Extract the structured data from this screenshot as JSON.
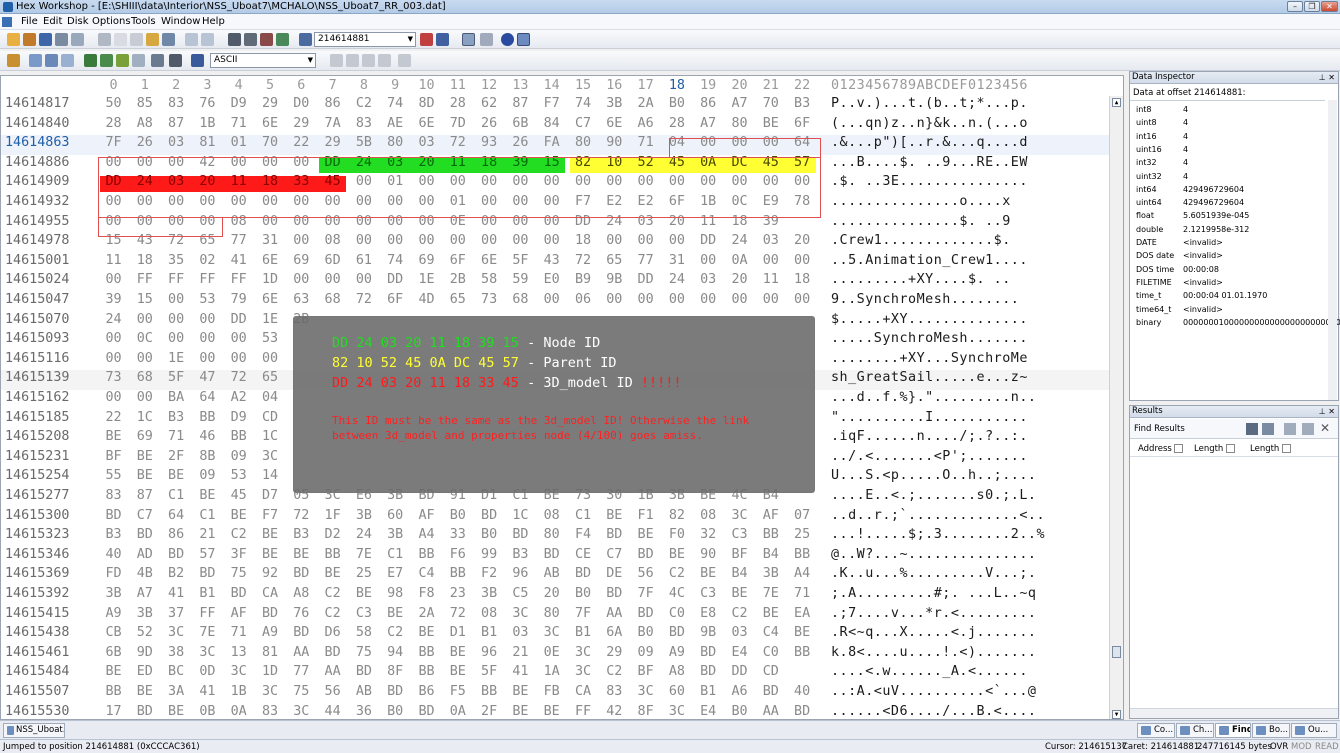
{
  "window": {
    "title": "Hex Workshop - [E:\\SHIII\\data\\Interior\\NSS_Uboat7\\MCHALO\\NSS_Uboat7_RR_003.dat]",
    "min": "–",
    "restore": "❐",
    "close": "✕"
  },
  "menu": [
    "File",
    "Edit",
    "Disk",
    "Options",
    "Tools",
    "Window",
    "Help"
  ],
  "toolbar": {
    "goto_value": "214614881",
    "charset": "ASCII"
  },
  "editor": {
    "col_headers": [
      "0",
      "1",
      "2",
      "3",
      "4",
      "5",
      "6",
      "7",
      "8",
      "9",
      "10",
      "11",
      "12",
      "13",
      "14",
      "15",
      "16",
      "17",
      "18",
      "19",
      "20",
      "21",
      "22"
    ],
    "ascii_header": "0123456789ABCDEF0123456",
    "rows": [
      {
        "off": "14614817",
        "hex": [
          "50",
          "85",
          "83",
          "76",
          "D9",
          "29",
          "D0",
          "86",
          "C2",
          "74",
          "8D",
          "28",
          "62",
          "87",
          "F7",
          "74",
          "3B",
          "2A",
          "B0",
          "86",
          "A7",
          "70",
          "B3"
        ],
        "ascii": "P..v.)...t.(b..t;*...p."
      },
      {
        "off": "14614840",
        "hex": [
          "28",
          "A8",
          "87",
          "1B",
          "71",
          "6E",
          "29",
          "7A",
          "83",
          "AE",
          "6E",
          "7D",
          "26",
          "6B",
          "84",
          "C7",
          "6E",
          "A6",
          "28",
          "A7",
          "80",
          "BE",
          "6F"
        ],
        "ascii": "(...qn)z..n}&k..n.(...o"
      },
      {
        "off": "14614863",
        "hex": [
          "7F",
          "26",
          "03",
          "81",
          "01",
          "70",
          "22",
          "29",
          "5B",
          "80",
          "03",
          "72",
          "93",
          "26",
          "FA",
          "80",
          "90",
          "71",
          "04",
          "00",
          "00",
          "00",
          "64"
        ],
        "ascii": ".&...p\")[..r.&...q....d"
      },
      {
        "off": "14614886",
        "hex": [
          "00",
          "00",
          "00",
          "42",
          "00",
          "00",
          "00",
          "DD",
          "24",
          "03",
          "20",
          "11",
          "18",
          "39",
          "15",
          "82",
          "10",
          "52",
          "45",
          "0A",
          "DC",
          "45",
          "57"
        ],
        "ascii": "...B....$. ..9...RE..EW"
      },
      {
        "off": "14614909",
        "hex": [
          "DD",
          "24",
          "03",
          "20",
          "11",
          "18",
          "33",
          "45",
          "00",
          "01",
          "00",
          "00",
          "00",
          "00",
          "00",
          "00",
          "00",
          "00",
          "00",
          "00",
          "00",
          "00",
          "00"
        ],
        "ascii": ".$. ..3E..............."
      },
      {
        "off": "14614932",
        "hex": [
          "00",
          "00",
          "00",
          "00",
          "00",
          "00",
          "00",
          "00",
          "00",
          "00",
          "00",
          "01",
          "00",
          "00",
          "00",
          "F7",
          "E2",
          "E2",
          "6F",
          "1B",
          "0C",
          "E9",
          "78"
        ],
        "ascii": "...............o....x"
      },
      {
        "off": "14614955",
        "hex": [
          "00",
          "00",
          "00",
          "00",
          "08",
          "00",
          "00",
          "00",
          "00",
          "00",
          "00",
          "0E",
          "00",
          "00",
          "00",
          "DD",
          "24",
          "03",
          "20",
          "11",
          "18",
          "39"
        ],
        "ascii": "...............$. ..9"
      },
      {
        "off": "14614978",
        "hex": [
          "15",
          "43",
          "72",
          "65",
          "77",
          "31",
          "00",
          "08",
          "00",
          "00",
          "00",
          "00",
          "00",
          "00",
          "00",
          "18",
          "00",
          "00",
          "00",
          "DD",
          "24",
          "03",
          "20"
        ],
        "ascii": ".Crew1.............$. "
      },
      {
        "off": "14615001",
        "hex": [
          "11",
          "18",
          "35",
          "02",
          "41",
          "6E",
          "69",
          "6D",
          "61",
          "74",
          "69",
          "6F",
          "6E",
          "5F",
          "43",
          "72",
          "65",
          "77",
          "31",
          "00",
          "0A",
          "00",
          "00"
        ],
        "ascii": "..5.Animation_Crew1...."
      },
      {
        "off": "14615024",
        "hex": [
          "00",
          "FF",
          "FF",
          "FF",
          "FF",
          "1D",
          "00",
          "00",
          "00",
          "DD",
          "1E",
          "2B",
          "58",
          "59",
          "E0",
          "B9",
          "9B",
          "DD",
          "24",
          "03",
          "20",
          "11",
          "18"
        ],
        "ascii": ".........+XY....$. .."
      },
      {
        "off": "14615047",
        "hex": [
          "39",
          "15",
          "00",
          "53",
          "79",
          "6E",
          "63",
          "68",
          "72",
          "6F",
          "4D",
          "65",
          "73",
          "68",
          "00",
          "06",
          "00",
          "00",
          "00",
          "00",
          "00",
          "00",
          "00"
        ],
        "ascii": "9..SynchroMesh........"
      },
      {
        "off": "14615070",
        "hex": [
          "24",
          "00",
          "00",
          "00",
          "DD",
          "1E",
          "2B"
        ],
        "ascii": "$.....+XY.............."
      },
      {
        "off": "14615093",
        "hex": [
          "00",
          "0C",
          "00",
          "00",
          "00",
          "53"
        ],
        "ascii": ".....SynchroMesh......."
      },
      {
        "off": "14615116",
        "hex": [
          "00",
          "00",
          "1E",
          "00",
          "00",
          "00"
        ],
        "ascii": "........+XY...SynchroMe"
      },
      {
        "off": "14615139",
        "hex": [
          "73",
          "68",
          "5F",
          "47",
          "72",
          "65"
        ],
        "ascii": "sh_GreatSail.....e...z~"
      },
      {
        "off": "14615162",
        "hex": [
          "00",
          "00",
          "BA",
          "64",
          "A2",
          "04"
        ],
        "ascii": "...d..f.%}.\".........n.."
      },
      {
        "off": "14615185",
        "hex": [
          "22",
          "1C",
          "B3",
          "BB",
          "D9",
          "CD"
        ],
        "ascii": "\"..........I..........."
      },
      {
        "off": "14615208",
        "hex": [
          "BE",
          "69",
          "71",
          "46",
          "BB",
          "1C"
        ],
        "ascii": ".iqF......n..../;.?..:."
      },
      {
        "off": "14615231",
        "hex": [
          "BF",
          "BE",
          "2F",
          "8B",
          "09",
          "3C"
        ],
        "ascii": "../.<.......<P';......."
      },
      {
        "off": "14615254",
        "hex": [
          "55",
          "BE",
          "BE",
          "09",
          "53",
          "14"
        ],
        "ascii": "U...S.<p.....O..h..;...."
      },
      {
        "off": "14615277",
        "hex": [
          "83",
          "87",
          "C1",
          "BE",
          "45",
          "D7",
          "05",
          "3C",
          "E6",
          "3B",
          "BD",
          "91",
          "D1",
          "C1",
          "BE",
          "73",
          "30",
          "1B",
          "3B",
          "BE",
          "4C",
          "B4"
        ],
        "ascii": "....E..<.;.......s0.;.L."
      },
      {
        "off": "14615300",
        "hex": [
          "BD",
          "C7",
          "64",
          "C1",
          "BE",
          "F7",
          "72",
          "1F",
          "3B",
          "60",
          "AF",
          "B0",
          "BD",
          "1C",
          "08",
          "C1",
          "BE",
          "F1",
          "82",
          "08",
          "3C",
          "AF",
          "07"
        ],
        "ascii": "..d..r.;`.............<.."
      },
      {
        "off": "14615323",
        "hex": [
          "B3",
          "BD",
          "86",
          "21",
          "C2",
          "BE",
          "B3",
          "D2",
          "24",
          "3B",
          "A4",
          "33",
          "B0",
          "BD",
          "80",
          "F4",
          "BD",
          "BE",
          "F0",
          "32",
          "C3",
          "BB",
          "25"
        ],
        "ascii": "...!.....$;.3........2..%"
      },
      {
        "off": "14615346",
        "hex": [
          "40",
          "AD",
          "BD",
          "57",
          "3F",
          "BE",
          "BE",
          "BB",
          "7E",
          "C1",
          "BB",
          "F6",
          "99",
          "B3",
          "BD",
          "CE",
          "C7",
          "BD",
          "BE",
          "90",
          "BF",
          "B4",
          "BB"
        ],
        "ascii": "@..W?...~..............."
      },
      {
        "off": "14615369",
        "hex": [
          "FD",
          "4B",
          "B2",
          "BD",
          "75",
          "92",
          "BD",
          "BE",
          "25",
          "E7",
          "C4",
          "BB",
          "F2",
          "96",
          "AB",
          "BD",
          "DE",
          "56",
          "C2",
          "BE",
          "B4",
          "3B",
          "A4"
        ],
        "ascii": ".K..u...%.........V...;."
      },
      {
        "off": "14615392",
        "hex": [
          "3B",
          "A7",
          "41",
          "B1",
          "BD",
          "CA",
          "A8",
          "C2",
          "BE",
          "98",
          "F8",
          "23",
          "3B",
          "C5",
          "20",
          "B0",
          "BD",
          "7F",
          "4C",
          "C3",
          "BE",
          "7E",
          "71"
        ],
        "ascii": ";.A.........#;. ...L..~q"
      },
      {
        "off": "14615415",
        "hex": [
          "A9",
          "3B",
          "37",
          "FF",
          "AF",
          "BD",
          "76",
          "C2",
          "C3",
          "BE",
          "2A",
          "72",
          "08",
          "3C",
          "80",
          "7F",
          "AA",
          "BD",
          "C0",
          "E8",
          "C2",
          "BE",
          "EA"
        ],
        "ascii": ".;7....v...*r.<........."
      },
      {
        "off": "14615438",
        "hex": [
          "CB",
          "52",
          "3C",
          "7E",
          "71",
          "A9",
          "BD",
          "D6",
          "58",
          "C2",
          "BE",
          "D1",
          "B1",
          "03",
          "3C",
          "B1",
          "6A",
          "B0",
          "BD",
          "9B",
          "03",
          "C4",
          "BE"
        ],
        "ascii": ".R<~q...X.....<.j......."
      },
      {
        "off": "14615461",
        "hex": [
          "6B",
          "9D",
          "38",
          "3C",
          "13",
          "81",
          "AA",
          "BD",
          "75",
          "94",
          "BB",
          "BE",
          "96",
          "21",
          "0E",
          "3C",
          "29",
          "09",
          "A9",
          "BD",
          "E4",
          "C0",
          "BB"
        ],
        "ascii": "k.8<....u....!.<)......."
      },
      {
        "off": "14615484",
        "hex": [
          "BE",
          "ED",
          "BC",
          "0D",
          "3C",
          "1D",
          "77",
          "AA",
          "BD",
          "8F",
          "BB",
          "BE",
          "5F",
          "41",
          "1A",
          "3C",
          "C2",
          "BF",
          "A8",
          "BD",
          "DD",
          "CD"
        ],
        "ascii": "....<.w......_A.<......"
      },
      {
        "off": "14615507",
        "hex": [
          "BB",
          "BE",
          "3A",
          "41",
          "1B",
          "3C",
          "75",
          "56",
          "AB",
          "BD",
          "B6",
          "F5",
          "BB",
          "BE",
          "FB",
          "CA",
          "83",
          "3C",
          "60",
          "B1",
          "A6",
          "BD",
          "40"
        ],
        "ascii": "..:A.<uV..........<`...@"
      },
      {
        "off": "14615530",
        "hex": [
          "17",
          "BD",
          "BE",
          "0B",
          "0A",
          "83",
          "3C",
          "44",
          "36",
          "B0",
          "BD",
          "0A",
          "2F",
          "BE",
          "BE",
          "FF",
          "42",
          "8F",
          "3C",
          "E4",
          "B0",
          "AA",
          "BD"
        ],
        "ascii": "......<D6..../...B.<...."
      }
    ]
  },
  "overlay": {
    "line1_hex": "DD 24 03 20 11 18 39 15",
    "line1_label": " - Node ID",
    "line2_hex": "82 10 52 45 0A DC 45 57",
    "line2_label": " - Parent ID",
    "line3_hex": "DD 24 03 20 11 18 33 45",
    "line3_label": " - 3D_model ID",
    "line3_bang": "  !!!!!",
    "note": "This ID must be the same as the 3d_model ID! Otherwise the link between 3d_model and properties node (4/100) goes amiss."
  },
  "inspector": {
    "title": "Data Inspector",
    "subtitle": "Data at offset 214614881:",
    "rows": [
      {
        "k": "int8",
        "v": "4"
      },
      {
        "k": "uint8",
        "v": "4"
      },
      {
        "k": "int16",
        "v": "4"
      },
      {
        "k": "uint16",
        "v": "4"
      },
      {
        "k": "int32",
        "v": "4"
      },
      {
        "k": "uint32",
        "v": "4"
      },
      {
        "k": "int64",
        "v": "429496729604"
      },
      {
        "k": "uint64",
        "v": "429496729604"
      },
      {
        "k": "float",
        "v": "5.6051939e-045"
      },
      {
        "k": "double",
        "v": "2.1219958e-312"
      },
      {
        "k": "DATE",
        "v": "<invalid>"
      },
      {
        "k": "DOS date",
        "v": "<invalid>"
      },
      {
        "k": "DOS time",
        "v": "00:00:08"
      },
      {
        "k": "FILETIME",
        "v": "<invalid>"
      },
      {
        "k": "time_t",
        "v": "00:00:04 01.01.1970"
      },
      {
        "k": "time64_t",
        "v": "<invalid>"
      },
      {
        "k": "binary",
        "v": "00000001000000000000000000000000..."
      }
    ]
  },
  "results": {
    "title": "Results",
    "find_label": "Find Results",
    "cols": [
      "Address",
      "Length",
      "Length"
    ]
  },
  "bottom": {
    "doc_tab": "NSS_Uboat...",
    "right_tabs": [
      "Co...",
      "Ch...",
      "Find",
      "Bo...",
      "Ou..."
    ]
  },
  "status": {
    "msg": "Jumped to position 214614881 (0xCCCAC361)",
    "cursor": "Cursor: 214615137",
    "caret": "Caret: 214614881",
    "size": "247716145 bytes",
    "ovr": "OVR",
    "mod": "MOD",
    "read": "READ"
  },
  "colors": {
    "green": "#22dd22",
    "yellow": "#ffff33",
    "red": "#ff1a1a",
    "frame": "#e05050"
  }
}
